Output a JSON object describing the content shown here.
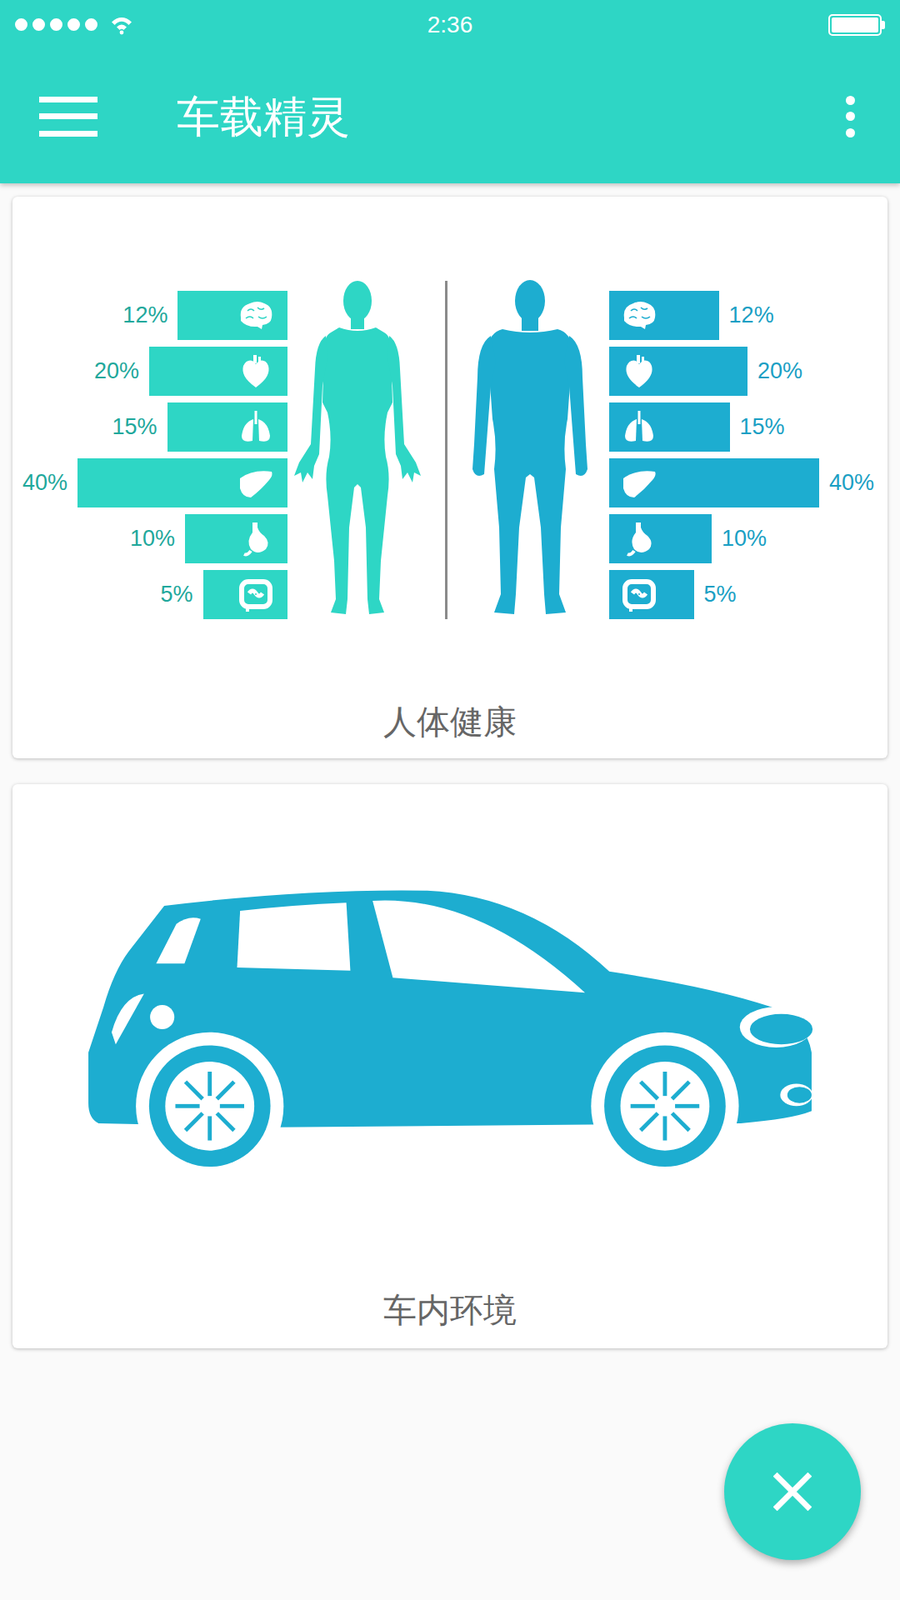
{
  "status_bar": {
    "time": "2:36",
    "signal": 1,
    "battery": 1
  },
  "app_bar": {
    "title": "车载精灵"
  },
  "cards": [
    {
      "kind": "body-chart",
      "label": "人体健康",
      "series": [
        {
          "color": "#2ED6C5",
          "values": [
            12,
            20,
            15,
            40,
            10,
            5
          ],
          "labels": [
            "12%",
            "20%",
            "15%",
            "40%",
            "10%",
            "5%"
          ]
        },
        {
          "color": "#1DADD0",
          "values": [
            12,
            20,
            15,
            40,
            10,
            5
          ],
          "labels": [
            "12%",
            "20%",
            "15%",
            "40%",
            "10%",
            "5%"
          ]
        }
      ]
    },
    {
      "kind": "car",
      "label": "车内环境"
    }
  ]
}
